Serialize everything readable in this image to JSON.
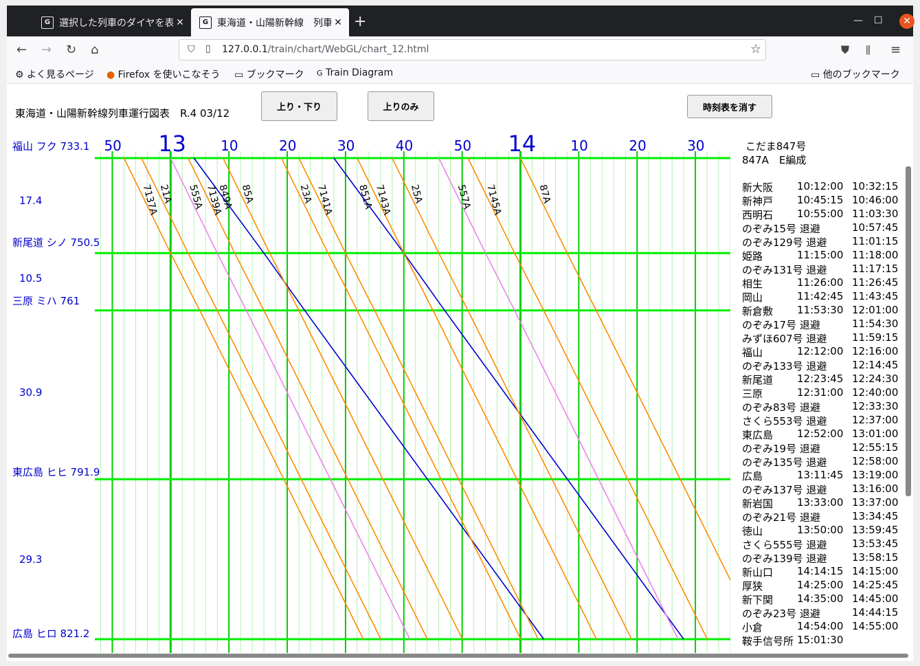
{
  "tabs": [
    {
      "favicon": "G",
      "title": "選択した列車のダイヤを表示する"
    },
    {
      "favicon": "G",
      "title": "東海道・山陽新幹線　列車運行図表"
    }
  ],
  "nav": {
    "url_host": "127.0.0.1",
    "url_path": "/train/chart/WebGL/chart_12.html"
  },
  "bookmarks": {
    "items": [
      "よく見るページ",
      "Firefox を使いこなそう",
      "ブックマーク",
      "Train Diagram"
    ],
    "other": "他のブックマーク"
  },
  "page": {
    "title": "東海道・山陽新幹線列車運行図表　R.4 03/12",
    "btn_both": "上り・下り",
    "btn_up": "上りのみ",
    "btn_clear": "時刻表を消す"
  },
  "chart_data": {
    "type": "line",
    "x_axis": {
      "unit": "time",
      "start": "12:47",
      "end": "14:36",
      "tick_labels": [
        "50",
        "13",
        "10",
        "20",
        "30",
        "40",
        "50",
        "14",
        "10",
        "20",
        "30"
      ],
      "tick_times": [
        "12:50",
        "13:00",
        "13:10",
        "13:20",
        "13:30",
        "13:40",
        "13:50",
        "14:00",
        "14:10",
        "14:20",
        "14:30"
      ]
    },
    "stations": [
      {
        "label": "福山 フク 733.1",
        "km": 733.1
      },
      {
        "label": "新尾道 シノ 750.5",
        "km": 750.5
      },
      {
        "label": "三原 ミハ 761",
        "km": 761
      },
      {
        "label": "東広島 ヒヒ 791.9",
        "km": 791.9
      },
      {
        "label": "広島 ヒロ 821.2",
        "km": 821.2
      }
    ],
    "segment_labels": [
      "17.4",
      "10.5",
      "30.9",
      "29.3"
    ],
    "grid": true,
    "colors": {
      "kodama": "#0000cc",
      "nozomi": "#ff8c00",
      "sakura": "#ee82ee",
      "grid_minor": "#b0f0b0",
      "grid_major": "#00cc00",
      "grid_station": "#00ee00"
    },
    "series": [
      {
        "name": "7137A",
        "color": "#ff8c00",
        "x": [
          "12:52",
          "13:00",
          "13:05"
        ],
        "y": [
          733.1,
          750.5,
          761
        ]
      },
      {
        "name": "21A",
        "color": "#ff8c00",
        "x": [
          "12:55",
          "13:03",
          "13:08"
        ],
        "y": [
          733.1,
          750.5,
          761
        ]
      },
      {
        "name": "555A",
        "color": "#ee82ee",
        "x": [
          "13:00",
          "13:08",
          "13:13"
        ],
        "y": [
          733.1,
          750.5,
          761
        ]
      },
      {
        "name": "7139A",
        "color": "#ff8c00",
        "x": [
          "13:03",
          "13:11",
          "13:16"
        ],
        "y": [
          733.1,
          750.5,
          761
        ]
      },
      {
        "name": "849A",
        "color": "#0000cc",
        "x": [
          "13:04",
          "13:16",
          "13:23"
        ],
        "y": [
          733.1,
          750.5,
          761
        ]
      },
      {
        "name": "85A",
        "color": "#ff8c00",
        "x": [
          "13:09",
          "13:17",
          "13:22"
        ],
        "y": [
          733.1,
          750.5,
          761
        ]
      },
      {
        "name": "23A",
        "color": "#ff8c00",
        "x": [
          "13:19",
          "13:27",
          "13:32"
        ],
        "y": [
          733.1,
          750.5,
          761
        ]
      },
      {
        "name": "7141A",
        "color": "#ff8c00",
        "x": [
          "13:22",
          "13:30",
          "13:35"
        ],
        "y": [
          733.1,
          750.5,
          761
        ]
      },
      {
        "name": "851A",
        "color": "#0000cc",
        "x": [
          "13:28",
          "13:40",
          "13:47"
        ],
        "y": [
          733.1,
          750.5,
          761
        ]
      },
      {
        "name": "7143A",
        "color": "#ff8c00",
        "x": [
          "13:32",
          "13:40",
          "13:45"
        ],
        "y": [
          733.1,
          750.5,
          761
        ]
      },
      {
        "name": "25A",
        "color": "#ff8c00",
        "x": [
          "13:38",
          "13:46",
          "13:51"
        ],
        "y": [
          733.1,
          750.5,
          761
        ]
      },
      {
        "name": "557A",
        "color": "#ee82ee",
        "x": [
          "13:46",
          "13:54",
          "13:59"
        ],
        "y": [
          733.1,
          750.5,
          761
        ]
      },
      {
        "name": "7145A",
        "color": "#ff8c00",
        "x": [
          "13:51",
          "13:59",
          "14:04"
        ],
        "y": [
          733.1,
          750.5,
          761
        ]
      },
      {
        "name": "87A",
        "color": "#ff8c00",
        "x": [
          "14:00",
          "14:08",
          "14:13"
        ],
        "y": [
          733.1,
          750.5,
          761
        ]
      }
    ]
  },
  "timetable": {
    "title": "こだま847号",
    "subtitle": "847A　E編成",
    "rows": [
      [
        "新大阪",
        "10:12:00",
        "10:32:15"
      ],
      [
        "新神戸",
        "10:45:15",
        "10:46:00"
      ],
      [
        "西明石",
        "10:55:00",
        "11:03:30"
      ],
      [
        "のぞみ15号 退避",
        "",
        "10:57:45"
      ],
      [
        "のぞみ129号 退避",
        "",
        "11:01:15"
      ],
      [
        "姫路",
        "11:15:00",
        "11:18:00"
      ],
      [
        "のぞみ131号 退避",
        "",
        "11:17:15"
      ],
      [
        "相生",
        "11:26:00",
        "11:26:45"
      ],
      [
        "岡山",
        "11:42:45",
        "11:43:45"
      ],
      [
        "新倉敷",
        "11:53:30",
        "12:01:00"
      ],
      [
        "のぞみ17号 退避",
        "",
        "11:54:30"
      ],
      [
        "みずほ607号 退避",
        "",
        "11:59:15"
      ],
      [
        "福山",
        "12:12:00",
        "12:16:00"
      ],
      [
        "のぞみ133号 退避",
        "",
        "12:14:45"
      ],
      [
        "新尾道",
        "12:23:45",
        "12:24:30"
      ],
      [
        "三原",
        "12:31:00",
        "12:40:00"
      ],
      [
        "のぞみ83号 退避",
        "",
        "12:33:30"
      ],
      [
        "さくら553号 退避",
        "",
        "12:37:00"
      ],
      [
        "東広島",
        "12:52:00",
        "13:01:00"
      ],
      [
        "のぞみ19号 退避",
        "",
        "12:55:15"
      ],
      [
        "のぞみ135号 退避",
        "",
        "12:58:00"
      ],
      [
        "広島",
        "13:11:45",
        "13:19:00"
      ],
      [
        "のぞみ137号 退避",
        "",
        "13:16:00"
      ],
      [
        "新岩国",
        "13:33:00",
        "13:37:00"
      ],
      [
        "のぞみ21号 退避",
        "",
        "13:34:45"
      ],
      [
        "徳山",
        "13:50:00",
        "13:59:45"
      ],
      [
        "さくら555号 退避",
        "",
        "13:53:45"
      ],
      [
        "のぞみ139号 退避",
        "",
        "13:58:15"
      ],
      [
        "新山口",
        "14:14:15",
        "14:15:00"
      ],
      [
        "厚狭",
        "14:25:00",
        "14:25:45"
      ],
      [
        "新下関",
        "14:35:00",
        "14:45:00"
      ],
      [
        "のぞみ23号 退避",
        "",
        "14:44:15"
      ],
      [
        "小倉",
        "14:54:00",
        "14:55:00"
      ],
      [
        "鞍手信号所",
        "15:01:30",
        ""
      ]
    ]
  }
}
